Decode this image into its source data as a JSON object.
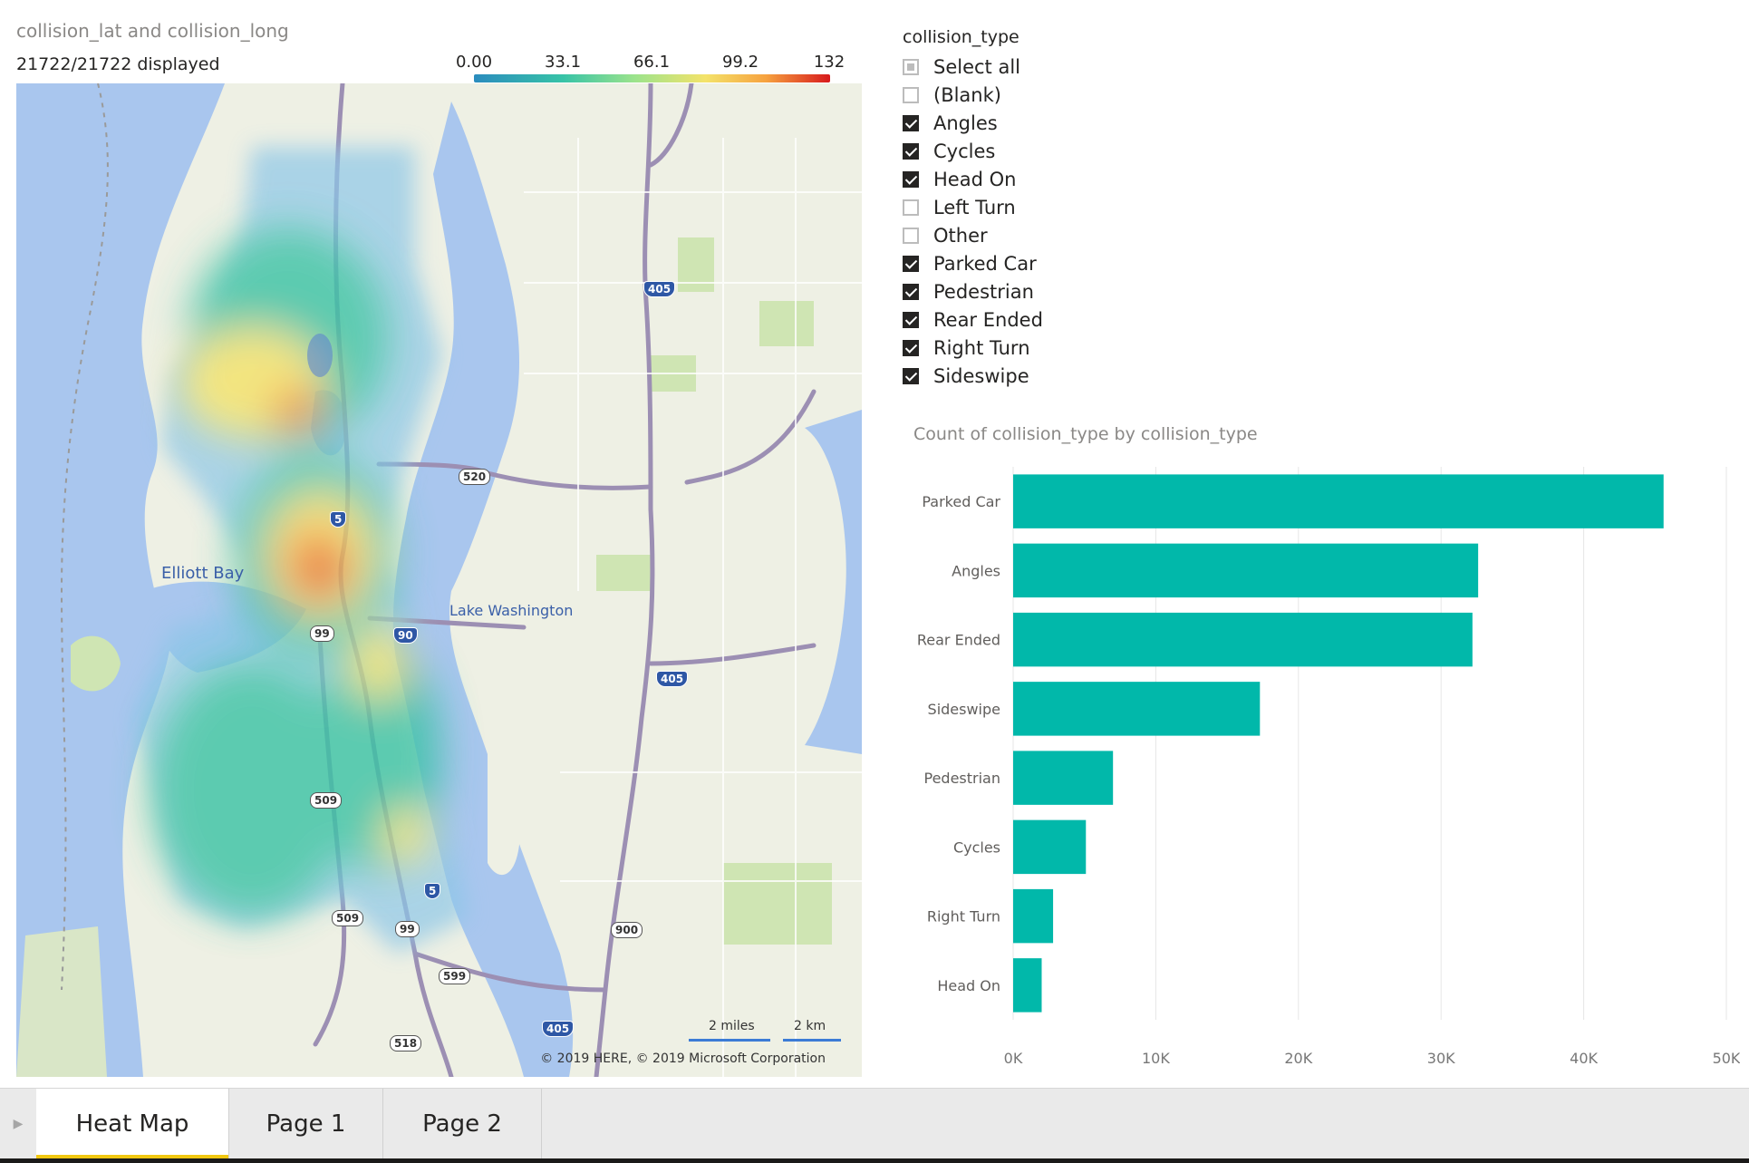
{
  "map": {
    "title": "collision_lat and collision_long",
    "status": "21722/21722 displayed",
    "legend_ticks": [
      "0.00",
      "33.1",
      "66.1",
      "99.2",
      "132"
    ],
    "labels": {
      "elliott_bay": "Elliott Bay",
      "lake_washington": "Lake Washington"
    },
    "shields": {
      "i405_north": "405",
      "i405_mid": "405",
      "i405_south": "405",
      "i5_north": "5",
      "i5_south": "5",
      "i90": "90",
      "sr520": "520",
      "sr99_north": "99",
      "sr99_south": "99",
      "sr509_north": "509",
      "sr509_south": "509",
      "sr599": "599",
      "sr518": "518",
      "sr900": "900"
    },
    "scale_miles": "2 miles",
    "scale_km": "2 km",
    "copyright": "© 2019 HERE, © 2019 Microsoft Corporation"
  },
  "slicer": {
    "title": "collision_type",
    "items": [
      {
        "label": "Select all",
        "state": "partial"
      },
      {
        "label": "(Blank)",
        "state": "unchecked"
      },
      {
        "label": "Angles",
        "state": "checked"
      },
      {
        "label": "Cycles",
        "state": "checked"
      },
      {
        "label": "Head On",
        "state": "checked"
      },
      {
        "label": "Left Turn",
        "state": "unchecked"
      },
      {
        "label": "Other",
        "state": "unchecked"
      },
      {
        "label": "Parked Car",
        "state": "checked"
      },
      {
        "label": "Pedestrian",
        "state": "checked"
      },
      {
        "label": "Rear Ended",
        "state": "checked"
      },
      {
        "label": "Right Turn",
        "state": "checked"
      },
      {
        "label": "Sideswipe",
        "state": "checked"
      }
    ]
  },
  "chart_data": {
    "type": "bar",
    "orientation": "horizontal",
    "title": "Count of collision_type by collision_type",
    "categories": [
      "Parked Car",
      "Angles",
      "Rear Ended",
      "Sideswipe",
      "Pedestrian",
      "Cycles",
      "Right Turn",
      "Head On"
    ],
    "values": [
      45600,
      32600,
      32200,
      17300,
      7000,
      5100,
      2800,
      2000
    ],
    "xlim": [
      0,
      50000
    ],
    "xticks": [
      "0K",
      "10K",
      "20K",
      "30K",
      "40K",
      "50K"
    ],
    "grid": true,
    "bar_color": "#01b8aa"
  },
  "tabs": [
    {
      "label": "Heat Map",
      "active": true
    },
    {
      "label": "Page 1",
      "active": false
    },
    {
      "label": "Page 2",
      "active": false
    }
  ],
  "colors": {
    "accent_tab": "#f2c811",
    "bar": "#01b8aa",
    "water": "#a9c6ee"
  }
}
